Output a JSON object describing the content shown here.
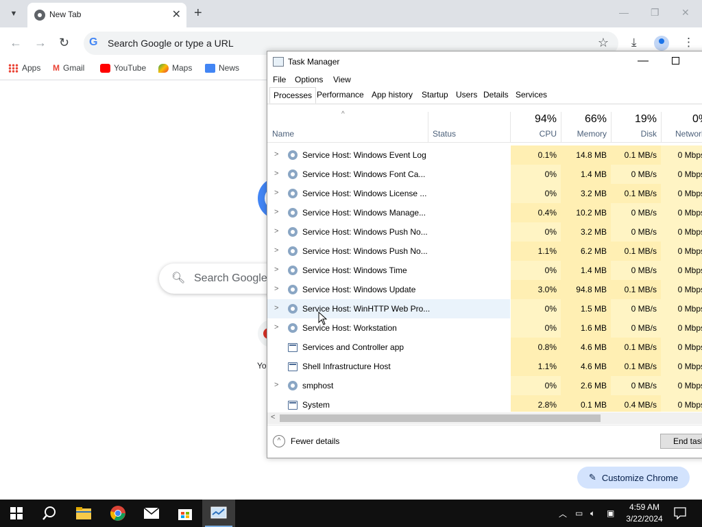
{
  "browser": {
    "tab_title": "New Tab",
    "omnibox_placeholder": "Search Google or type a URL",
    "bookmarks": [
      "Apps",
      "Gmail",
      "YouTube",
      "Maps",
      "News"
    ],
    "ntp_search_placeholder": "Search Google",
    "ntp_shortcut_label": "Yo",
    "customize_label": "Customize Chrome"
  },
  "taskmgr": {
    "title": "Task Manager",
    "menu": [
      "File",
      "Options",
      "View"
    ],
    "tabs": [
      "Processes",
      "Performance",
      "App history",
      "Startup",
      "Users",
      "Details",
      "Services"
    ],
    "active_tab": "Processes",
    "columns": {
      "name": "Name",
      "status": "Status",
      "cpu": {
        "pct": "94%",
        "label": "CPU"
      },
      "memory": {
        "pct": "66%",
        "label": "Memory"
      },
      "disk": {
        "pct": "19%",
        "label": "Disk"
      },
      "network": {
        "pct": "0%",
        "label": "Network"
      }
    },
    "rows": [
      {
        "name": "Service Host: Windows Event Log",
        "cpu": "0.1%",
        "mem": "14.8 MB",
        "disk": "0.1 MB/s",
        "net": "0 Mbps"
      },
      {
        "name": "Service Host: Windows Font Ca...",
        "cpu": "0%",
        "mem": "1.4 MB",
        "disk": "0 MB/s",
        "net": "0 Mbps"
      },
      {
        "name": "Service Host: Windows License ...",
        "cpu": "0%",
        "mem": "3.2 MB",
        "disk": "0.1 MB/s",
        "net": "0 Mbps"
      },
      {
        "name": "Service Host: Windows Manage...",
        "cpu": "0.4%",
        "mem": "10.2 MB",
        "disk": "0 MB/s",
        "net": "0 Mbps"
      },
      {
        "name": "Service Host: Windows Push No...",
        "cpu": "0%",
        "mem": "3.2 MB",
        "disk": "0 MB/s",
        "net": "0 Mbps"
      },
      {
        "name": "Service Host: Windows Push No...",
        "cpu": "1.1%",
        "mem": "6.2 MB",
        "disk": "0.1 MB/s",
        "net": "0 Mbps"
      },
      {
        "name": "Service Host: Windows Time",
        "cpu": "0%",
        "mem": "1.4 MB",
        "disk": "0 MB/s",
        "net": "0 Mbps"
      },
      {
        "name": "Service Host: Windows Update",
        "cpu": "3.0%",
        "mem": "94.8 MB",
        "disk": "0.1 MB/s",
        "net": "0 Mbps"
      },
      {
        "name": "Service Host: WinHTTP Web Pro...",
        "cpu": "0%",
        "mem": "1.5 MB",
        "disk": "0 MB/s",
        "net": "0 Mbps"
      },
      {
        "name": "Service Host: Workstation",
        "cpu": "0%",
        "mem": "1.6 MB",
        "disk": "0 MB/s",
        "net": "0 Mbps"
      },
      {
        "name": "Services and Controller app",
        "cpu": "0.8%",
        "mem": "4.6 MB",
        "disk": "0.1 MB/s",
        "net": "0 Mbps"
      },
      {
        "name": "Shell Infrastructure Host",
        "cpu": "1.1%",
        "mem": "4.6 MB",
        "disk": "0.1 MB/s",
        "net": "0 Mbps"
      },
      {
        "name": "smphost",
        "cpu": "0%",
        "mem": "2.6 MB",
        "disk": "0 MB/s",
        "net": "0 Mbps"
      },
      {
        "name": "System",
        "cpu": "2.8%",
        "mem": "0.1 MB",
        "disk": "0.4 MB/s",
        "net": "0 Mbps"
      }
    ],
    "fewer_details": "Fewer details",
    "end_task": "End task"
  },
  "taskbar": {
    "time": "4:59 AM",
    "date": "3/22/2024"
  },
  "colors": {
    "accent": "#1a73e8",
    "heat_light": "#fff4c4",
    "heat_mid": "#ffefb3",
    "taskbar": "#101010"
  }
}
